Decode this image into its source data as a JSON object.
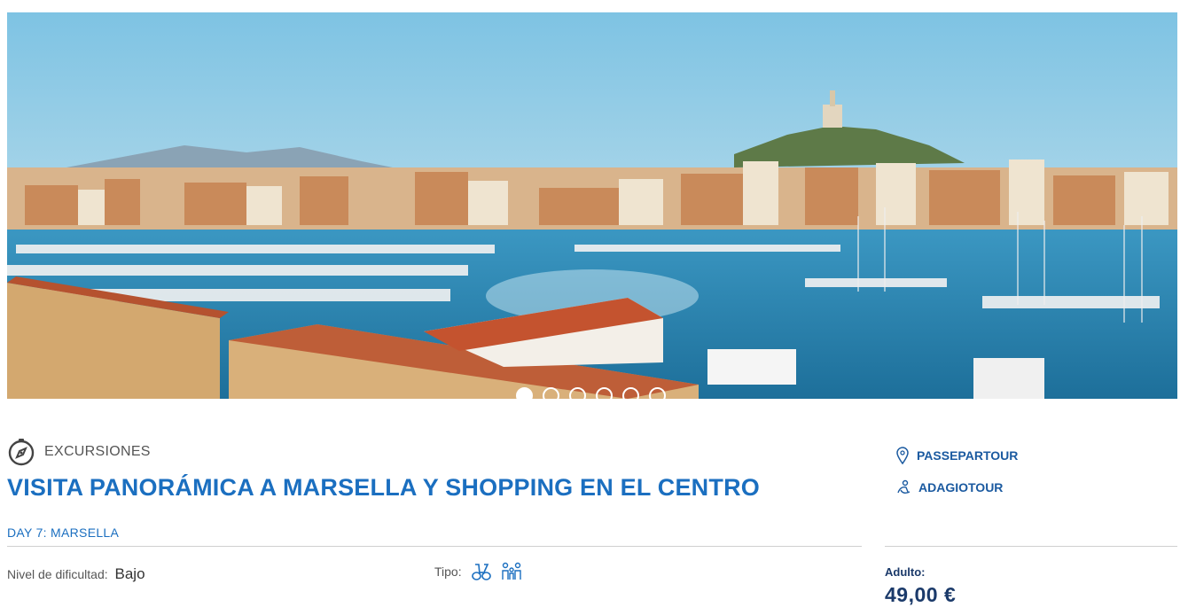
{
  "hero": {
    "image_label": "marseille-old-port-photo",
    "slide_count": 6,
    "active_slide": 1
  },
  "category": {
    "icon": "compass-icon",
    "label": "EXCURSIONES"
  },
  "title": "VISITA PANORÁMICA A MARSELLA Y SHOPPING EN EL CENTRO",
  "day": "DAY 7: MARSELLA",
  "difficulty": {
    "label": "Nivel de dificultad:",
    "value": "Bajo"
  },
  "tipo": {
    "label": "Tipo:",
    "icons": [
      "binoculars-icon",
      "family-icon"
    ]
  },
  "brands": [
    {
      "icon": "location-pin-icon",
      "label": "PASSEPARTOUR"
    },
    {
      "icon": "relax-icon",
      "label": "ADAGIOTOUR"
    }
  ],
  "pricing": {
    "adult_label": "Adulto:",
    "adult_price": "49,00 €"
  },
  "colors": {
    "accent": "#1b6fc0",
    "dark_blue": "#1b3a6a"
  }
}
